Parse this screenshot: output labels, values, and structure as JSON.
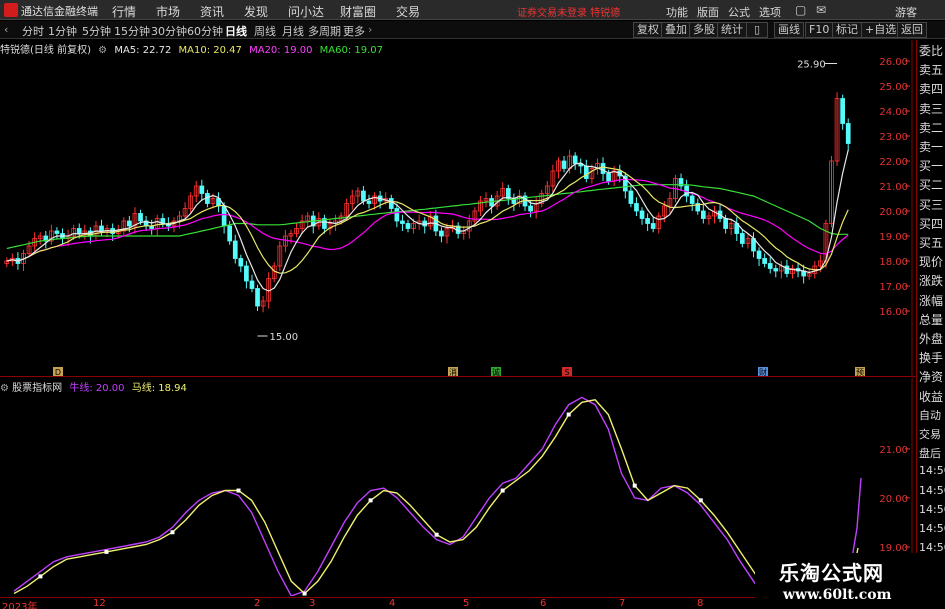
{
  "titlebar": {
    "app_title": "通达信金融终端",
    "menus": [
      "行情",
      "市场",
      "资讯",
      "发现",
      "问小达",
      "财富圈",
      "交易"
    ],
    "notice": "证券交易未登录  特锐德",
    "right_menus": [
      "功能",
      "版面",
      "公式",
      "选项"
    ],
    "guest": "游客"
  },
  "toolbar": {
    "periods": [
      "分时",
      "1分钟",
      "5分钟",
      "15分钟",
      "30分钟",
      "60分钟",
      "日线",
      "周线",
      "月线",
      "多周期",
      "更多"
    ],
    "active_period": "日线",
    "right_buttons": [
      "复权",
      "叠加",
      "多股",
      "统计",
      "画线",
      "F10",
      "标记",
      "+自选",
      "返回"
    ]
  },
  "main_legend": {
    "stock": "特锐德(日线 前复权)",
    "ma5": "MA5: 22.72",
    "ma10": "MA10: 20.47",
    "ma20": "MA20: 19.00",
    "ma60": "MA60: 19.07"
  },
  "sub_legend": {
    "name": "股票指标网",
    "line1": "牛线: 20.00",
    "line2": "马线: 18.94"
  },
  "colors": {
    "up": "#ff3232",
    "down": "#54fcfc",
    "ma5": "#e8e8e8",
    "ma10": "#e8e866",
    "ma20": "#ff00ff",
    "ma60": "#38e038",
    "niu": "#c040ff",
    "ma": "#f0f070",
    "axis_red": "#e33333"
  },
  "price_axis": [
    "26.00",
    "25.00",
    "24.00",
    "23.00",
    "22.00",
    "21.00",
    "20.00",
    "19.00",
    "18.00",
    "17.00",
    "16.00"
  ],
  "sub_axis": [
    "21.00",
    "20.00",
    "19.00"
  ],
  "annotations": {
    "high": "25.90",
    "low": "15.00"
  },
  "markers": [
    "D",
    "消",
    "诚",
    "S",
    "财",
    "预"
  ],
  "right_panel": [
    "委比",
    "卖五",
    "卖四",
    "卖三",
    "卖二",
    "卖一",
    "买一",
    "买二",
    "买三",
    "买四",
    "买五",
    "现价",
    "涨跌",
    "涨幅",
    "总量",
    "外盘",
    "换手",
    "净资",
    "收益",
    "自动",
    "交易",
    "盘后",
    "14:50",
    "14:50",
    "14:50",
    "14:50",
    "14:50",
    "14:50"
  ],
  "x_axis": [
    "2023年",
    "12",
    "2",
    "3",
    "4",
    "5",
    "6",
    "7",
    "8"
  ],
  "watermark": {
    "line1": "乐淘公式网",
    "line2": "www.60lt.com"
  },
  "chart_data": {
    "type": "line",
    "price_range": [
      15.0,
      26.2
    ],
    "close": [
      18.0,
      18.1,
      17.9,
      18.3,
      18.6,
      18.9,
      19.0,
      18.8,
      19.2,
      19.1,
      18.9,
      19.0,
      19.3,
      19.1,
      19.2,
      19.0,
      19.4,
      19.2,
      19.3,
      19.1,
      19.2,
      19.6,
      19.4,
      19.9,
      19.6,
      19.4,
      19.3,
      19.7,
      19.5,
      19.4,
      19.6,
      19.8,
      20.1,
      20.6,
      21.0,
      20.7,
      20.3,
      20.5,
      20.2,
      19.4,
      18.8,
      18.1,
      17.8,
      17.2,
      16.9,
      16.2,
      16.4,
      17.3,
      17.8,
      18.6,
      19.0,
      19.1,
      19.3,
      19.6,
      19.8,
      19.4,
      19.7,
      19.3,
      19.5,
      19.6,
      19.8,
      20.3,
      20.6,
      20.8,
      20.4,
      20.3,
      20.6,
      20.4,
      20.5,
      20.1,
      19.6,
      19.5,
      19.3,
      19.5,
      19.6,
      19.4,
      19.8,
      19.2,
      19.0,
      19.3,
      19.4,
      19.1,
      19.2,
      19.6,
      20.0,
      20.4,
      20.5,
      20.2,
      20.6,
      20.9,
      20.5,
      20.3,
      20.6,
      20.2,
      20.0,
      20.3,
      20.7,
      21.0,
      21.6,
      22.0,
      21.7,
      22.2,
      21.9,
      21.8,
      21.3,
      21.7,
      21.9,
      21.5,
      21.2,
      21.6,
      21.4,
      20.8,
      20.3,
      20.0,
      19.7,
      19.5,
      19.3,
      19.8,
      20.2,
      20.5,
      21.3,
      21.0,
      20.6,
      20.3,
      20.0,
      19.7,
      19.8,
      20.0,
      19.7,
      19.3,
      19.5,
      19.1,
      18.7,
      18.9,
      18.4,
      18.1,
      17.9,
      17.7,
      17.6,
      17.8,
      17.5,
      17.7,
      17.6,
      17.4,
      17.5,
      17.8,
      18.0,
      19.5,
      22.0,
      24.5,
      23.5,
      22.7
    ],
    "ma60": [
      18.5,
      18.55,
      18.6,
      18.65,
      18.7,
      18.75,
      18.8,
      18.82,
      18.85,
      18.88,
      18.9,
      18.92,
      18.95,
      18.97,
      18.98,
      19.0,
      19.0,
      19.0,
      19.0,
      19.0,
      19.0,
      19.0,
      19.0,
      19.0,
      19.0,
      19.0,
      19.0,
      19.0,
      19.0,
      19.0,
      19.0,
      19.0,
      19.05,
      19.1,
      19.15,
      19.2,
      19.25,
      19.3,
      19.35,
      19.4,
      19.45,
      19.5,
      19.5,
      19.5,
      19.48,
      19.45,
      19.45,
      19.45,
      19.45,
      19.45,
      19.47,
      19.5,
      19.52,
      19.55,
      19.57,
      19.6,
      19.62,
      19.65,
      19.67,
      19.7,
      19.72,
      19.75,
      19.77,
      19.8,
      19.82,
      19.85,
      19.87,
      19.9,
      19.92,
      19.95,
      19.97,
      19.98,
      20.0,
      20.02,
      20.05,
      20.07,
      20.1,
      20.12,
      20.15,
      20.17,
      20.2,
      20.22,
      20.25,
      20.27,
      20.3,
      20.32,
      20.35,
      20.37,
      20.4,
      20.42,
      20.45,
      20.47,
      20.5,
      20.52,
      20.55,
      20.57,
      20.6,
      20.62,
      20.65,
      20.67,
      20.7,
      20.72,
      20.75,
      20.77,
      20.8,
      20.82,
      20.85,
      20.87,
      20.9,
      20.92,
      20.95,
      20.97,
      21.0,
      21.02,
      21.05,
      21.05,
      21.05,
      21.05,
      21.05,
      21.05,
      21.05,
      21.05,
      21.05,
      21.03,
      21.0,
      20.97,
      20.95,
      20.92,
      20.9,
      20.85,
      20.8,
      20.75,
      20.7,
      20.65,
      20.6,
      20.5,
      20.4,
      20.3,
      20.2,
      20.1,
      20.0,
      19.9,
      19.8,
      19.7,
      19.6,
      19.45,
      19.3,
      19.2,
      19.1,
      19.07,
      19.07,
      19.07
    ],
    "ylabel_sub": "",
    "sub_range": [
      18.0,
      22.2
    ],
    "niu": [
      18.1,
      18.3,
      18.5,
      18.7,
      18.8,
      18.85,
      18.9,
      18.95,
      19.0,
      19.05,
      19.1,
      19.2,
      19.4,
      19.7,
      19.95,
      20.1,
      20.15,
      20.05,
      19.7,
      19.1,
      18.5,
      18.0,
      18.1,
      18.5,
      19.0,
      19.5,
      19.9,
      20.15,
      20.2,
      20.0,
      19.7,
      19.4,
      19.15,
      19.05,
      19.2,
      19.6,
      20.0,
      20.3,
      20.4,
      20.7,
      21.0,
      21.5,
      21.9,
      22.05,
      21.9,
      21.4,
      20.5,
      20.0,
      19.95,
      20.2,
      20.25,
      20.1,
      19.85,
      19.5,
      19.15,
      18.7,
      18.3,
      17.9,
      17.5
    ],
    "ma": [
      18.05,
      18.2,
      18.4,
      18.6,
      18.75,
      18.8,
      18.85,
      18.9,
      18.95,
      19.0,
      19.05,
      19.15,
      19.3,
      19.55,
      19.85,
      20.05,
      20.15,
      20.15,
      19.95,
      19.5,
      18.9,
      18.3,
      18.05,
      18.3,
      18.7,
      19.2,
      19.65,
      19.95,
      20.15,
      20.1,
      19.85,
      19.55,
      19.25,
      19.1,
      19.15,
      19.4,
      19.8,
      20.15,
      20.35,
      20.55,
      20.85,
      21.25,
      21.7,
      21.95,
      22.0,
      21.7,
      21.0,
      20.25,
      19.95,
      20.1,
      20.25,
      20.2,
      19.95,
      19.65,
      19.3,
      18.9,
      18.5,
      18.1,
      17.7
    ]
  }
}
